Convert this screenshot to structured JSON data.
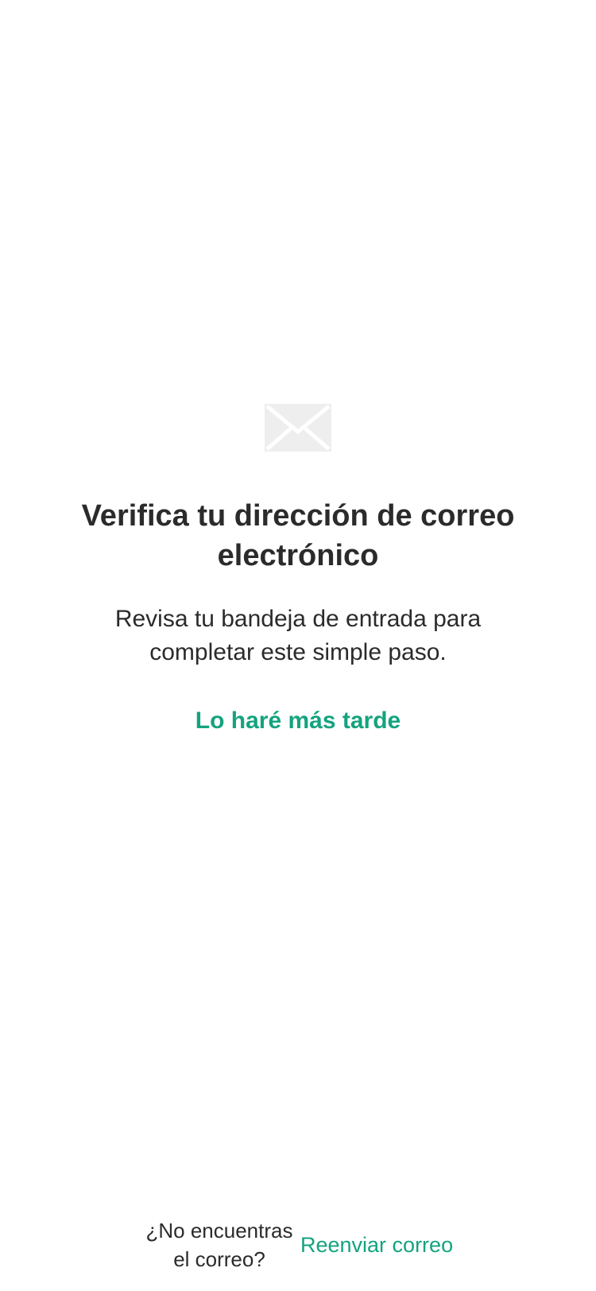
{
  "colors": {
    "accent": "#14a37f",
    "text": "#2b2b2b",
    "icon": "#eeeeee",
    "background": "#ffffff"
  },
  "icon": {
    "name": "envelope-icon"
  },
  "verify": {
    "title": "Verifica tu dirección de correo electrónico",
    "subtitle": "Revisa tu bandeja de entrada para completar este simple paso.",
    "later_label": "Lo haré más tarde"
  },
  "footer": {
    "question": "¿No encuentras el correo?",
    "resend_label": "Reenviar correo"
  }
}
